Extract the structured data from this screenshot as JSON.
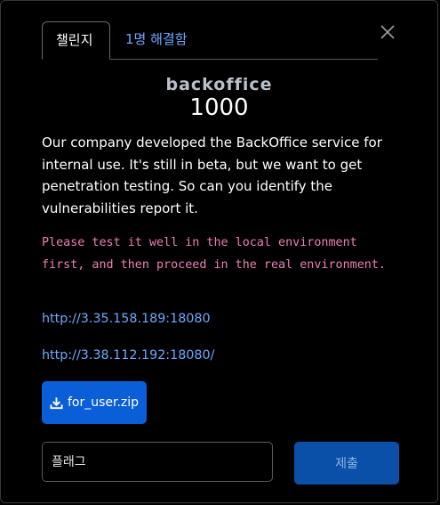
{
  "tabs": [
    {
      "label": "챌린지",
      "active": true
    },
    {
      "label": "1명 해결함",
      "active": false
    }
  ],
  "challenge": {
    "title": "backoffice",
    "points": "1000",
    "description": "Our company developed the BackOffice service for internal use. It's still in beta, but we want to get penetration testing. So can you identify the vulnerabilities report it.",
    "note": "Please test it well in the local environment first, and then proceed in the real environment.",
    "links": [
      "http://3.35.158.189:18080",
      "http://3.38.112.192:18080/"
    ],
    "download_label": "for_user.zip"
  },
  "form": {
    "flag_placeholder": "플래그",
    "submit_label": "제출"
  },
  "colors": {
    "link": "#6ea8fe",
    "note_text": "#ef7fb5",
    "primary_button": "#0a5ed7",
    "submit_button": "#0a4fa8"
  },
  "icons": {
    "close": "close-icon",
    "download": "download-icon"
  }
}
